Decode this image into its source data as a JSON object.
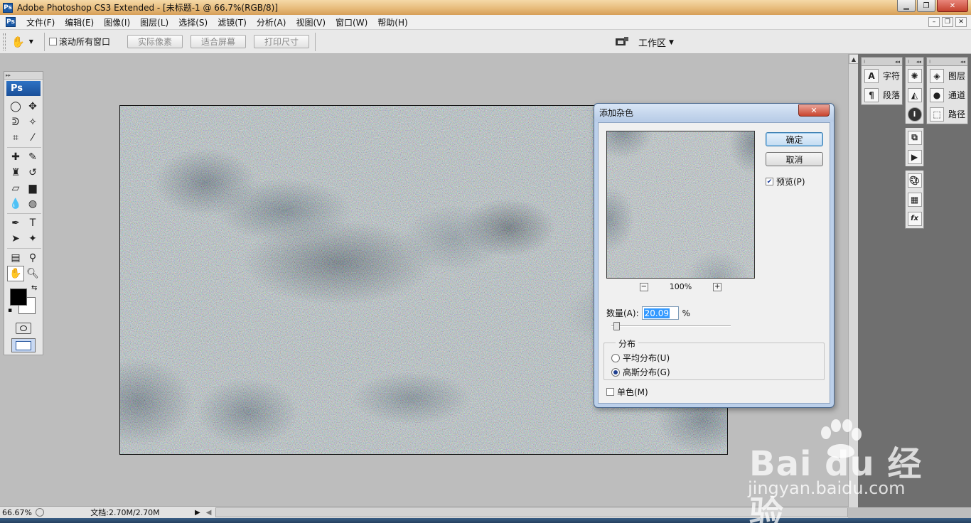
{
  "app": {
    "title": "Adobe Photoshop CS3 Extended - [未标题-1 @ 66.7%(RGB/8)]",
    "logo": "Ps"
  },
  "menubar": {
    "items": [
      "文件(F)",
      "编辑(E)",
      "图像(I)",
      "图层(L)",
      "选择(S)",
      "滤镜(T)",
      "分析(A)",
      "视图(V)",
      "窗口(W)",
      "帮助(H)"
    ]
  },
  "options": {
    "scroll_all_label": "滚动所有窗口",
    "actual_pixels": "实际像素",
    "fit_screen": "适合屏幕",
    "print_size": "打印尺寸",
    "workspace": "工作区"
  },
  "tools_panel": {
    "logo": "Ps",
    "icons": [
      "marquee-icon",
      "move-icon",
      "lasso-icon",
      "magic-wand-icon",
      "crop-icon",
      "slice-icon",
      "healing-icon",
      "brush-icon",
      "clone-stamp-icon",
      "history-brush-icon",
      "eraser-icon",
      "gradient-icon",
      "blur-icon",
      "dodge-icon",
      "pen-icon",
      "type-icon",
      "path-select-icon",
      "shape-icon",
      "notes-icon",
      "eyedropper-icon",
      "hand-icon",
      "zoom-icon"
    ],
    "foreground_color": "#000000",
    "background_color": "#ffffff"
  },
  "panels": {
    "col1": [
      {
        "label": "字符",
        "icon": "A"
      },
      {
        "label": "段落",
        "icon": "¶"
      }
    ],
    "col3": [
      {
        "label": "图层"
      },
      {
        "label": "通道"
      },
      {
        "label": "路径"
      }
    ]
  },
  "dialog": {
    "title": "添加杂色",
    "ok": "确定",
    "cancel": "取消",
    "preview_label": "预览(P)",
    "preview_checked": true,
    "zoom": "100%",
    "amount_label": "数量(A):",
    "amount_value": "20.09",
    "amount_unit": "%",
    "distribution_label": "分布",
    "uniform_label": "平均分布(U)",
    "gaussian_label": "高斯分布(G)",
    "selected_distribution": "gaussian",
    "mono_label": "单色(M)",
    "mono_checked": false
  },
  "status": {
    "zoom": "66.67%",
    "doc_info": "文档:2.70M/2.70M"
  },
  "watermark": {
    "brand": "Bai du 经验",
    "url": "jingyan.baidu.com"
  }
}
